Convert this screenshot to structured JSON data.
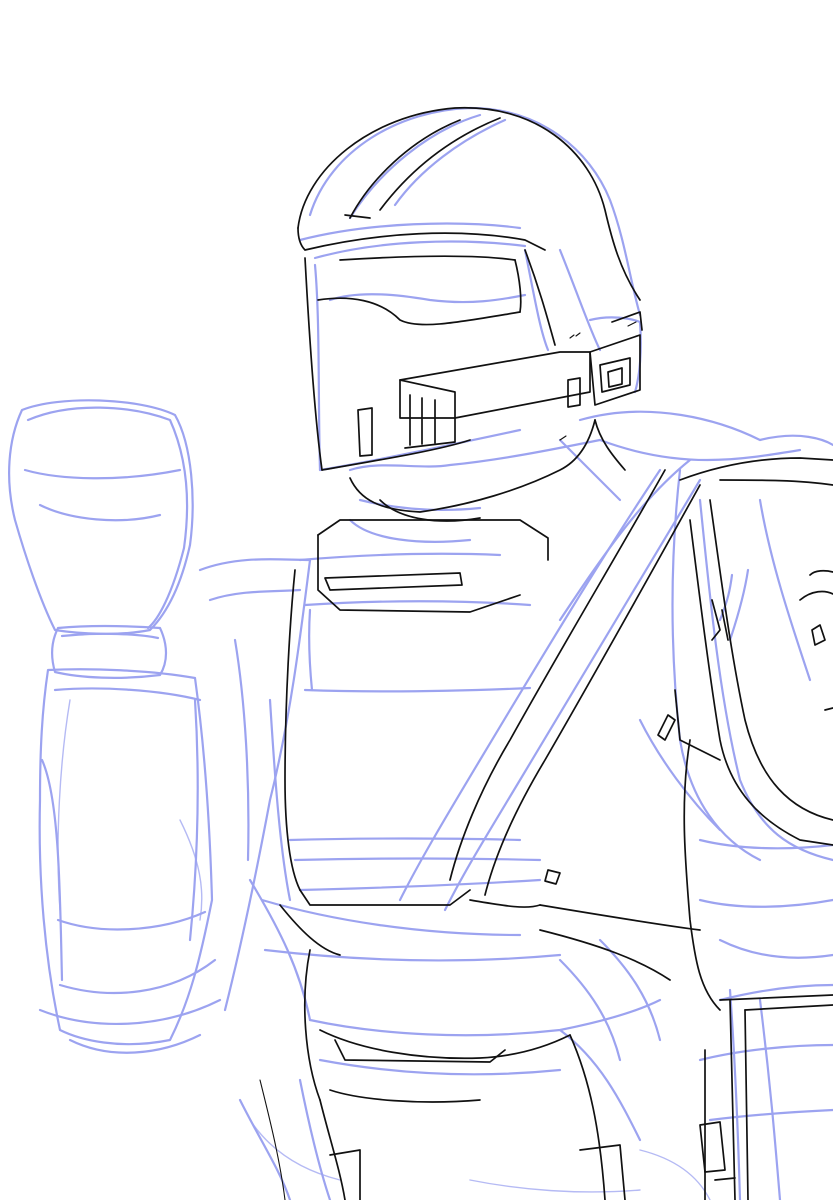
{
  "artwork": {
    "subject": "armored-soldier-sketch",
    "background_color": "#ffffff",
    "sketch_color": "#8b93ee",
    "lineart_color": "#111111"
  }
}
